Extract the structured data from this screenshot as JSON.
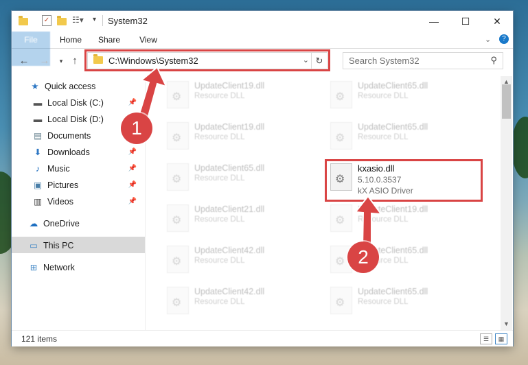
{
  "window": {
    "title": "System32",
    "controls": {
      "minimize": "—",
      "maximize": "☐",
      "close": "✕"
    }
  },
  "ribbon": {
    "tabs": [
      "File",
      "Home",
      "Share",
      "View"
    ],
    "expand_icon": "chevron-down-icon",
    "help_icon": "help-icon"
  },
  "address": {
    "path": "C:\\Windows\\System32",
    "search_placeholder": "Search System32"
  },
  "sidebar": {
    "items": [
      {
        "label": "Quick access",
        "icon": "star-icon",
        "pinned": false
      },
      {
        "label": "Local Disk (C:)",
        "icon": "drive-icon",
        "pinned": true
      },
      {
        "label": "Local Disk (D:)",
        "icon": "drive-icon",
        "pinned": true
      },
      {
        "label": "Documents",
        "icon": "documents-icon",
        "pinned": true
      },
      {
        "label": "Downloads",
        "icon": "download-icon",
        "pinned": true
      },
      {
        "label": "Music",
        "icon": "music-icon",
        "pinned": true
      },
      {
        "label": "Pictures",
        "icon": "pictures-icon",
        "pinned": true
      },
      {
        "label": "Videos",
        "icon": "videos-icon",
        "pinned": true
      },
      {
        "label": "OneDrive",
        "icon": "cloud-icon",
        "pinned": false
      },
      {
        "label": "This PC",
        "icon": "pc-icon",
        "pinned": false,
        "selected": true
      },
      {
        "label": "Network",
        "icon": "network-icon",
        "pinned": false
      }
    ]
  },
  "files": {
    "left": [
      {
        "name": "UpdateClient19.dll",
        "type": "Resource DLL"
      },
      {
        "name": "UpdateClient19.dll",
        "type": "Resource DLL"
      },
      {
        "name": "UpdateClient65.dll",
        "type": "Resource DLL"
      },
      {
        "name": "UpdateClient21.dll",
        "type": "Resource DLL"
      },
      {
        "name": "UpdateClient42.dll",
        "type": "Resource DLL"
      },
      {
        "name": "UpdateClient42.dll",
        "type": "Resource DLL"
      }
    ],
    "right": [
      {
        "name": "UpdateClient65.dll",
        "type": "Resource DLL"
      },
      {
        "name": "UpdateClient65.dll",
        "type": "Resource DLL"
      },
      {
        "name": "kxasio.dll",
        "version": "5.10.0.3537",
        "description": "kX ASIO Driver",
        "highlighted": true
      },
      {
        "name": "UpdateClient19.dll",
        "type": "Resource DLL"
      },
      {
        "name": "UpdateClient65.dll",
        "type": "Resource DLL"
      },
      {
        "name": "UpdateClient65.dll",
        "type": "Resource DLL"
      }
    ]
  },
  "status": {
    "item_count": "121 items"
  },
  "callouts": {
    "step1": "1",
    "step2": "2"
  },
  "colors": {
    "accent": "#1979ca",
    "highlight": "#d94444",
    "selected": "#d9d9d9"
  }
}
